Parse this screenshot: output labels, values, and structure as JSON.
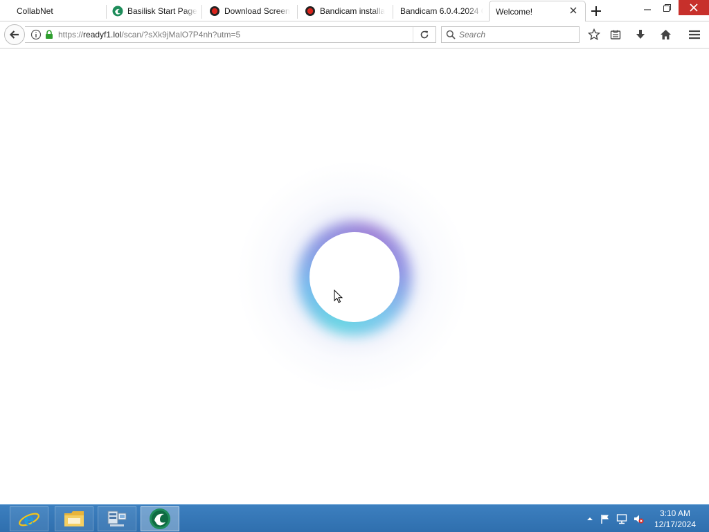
{
  "browser": {
    "tabs": [
      {
        "label": "CollabNet",
        "favicon": "none"
      },
      {
        "label": "Basilisk Start Page",
        "favicon": "basilisk-icon"
      },
      {
        "label": "Download Screen",
        "favicon": "bandicam-icon"
      },
      {
        "label": "Bandicam installa",
        "favicon": "bandicam-icon"
      },
      {
        "label": "Bandicam 6.0.4.2024 C",
        "favicon": "none"
      },
      {
        "label": "Welcome!",
        "favicon": "none",
        "active": true
      }
    ],
    "url": {
      "scheme": "https://",
      "domain": "readyf1.lol",
      "path": "/scan/?sXk9jMalO7P4nh?utm=5"
    },
    "search": {
      "placeholder": "Search",
      "value": ""
    },
    "toolbar_icons": [
      "bookmark-star-icon",
      "reading-list-icon",
      "downloads-icon",
      "home-icon",
      "menu-icon"
    ]
  },
  "content": {
    "loader_colors": {
      "teal": "#62d3e2",
      "blue": "#6fb7ec",
      "purple": "#9a7ad4"
    }
  },
  "taskbar": {
    "pinned": [
      "internet-explorer-icon",
      "file-explorer-icon",
      "server-manager-icon",
      "basilisk-taskbar-icon"
    ],
    "active_index": 3,
    "tray": [
      "show-hidden-icons-arrow",
      "action-center-flag-icon",
      "network-icon",
      "volume-muted-icon"
    ],
    "clock": {
      "time": "3:10 AM",
      "date": "12/17/2024"
    }
  },
  "colors": {
    "close_button": "#c7302b",
    "taskbar": "#3572b2"
  }
}
